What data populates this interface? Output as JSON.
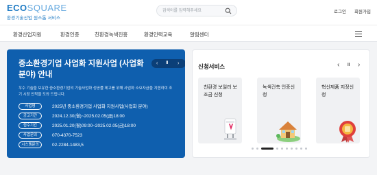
{
  "header": {
    "logo_main": "ECO",
    "logo_light": "SQUARE",
    "logo_sub": "환경기술산업 원스톱 서비스",
    "search_placeholder": "검색어를 입력해주세요",
    "login": "로그인",
    "signup": "회원가입"
  },
  "nav": {
    "items": [
      "환경산업지원",
      "환경인증",
      "친환경녹색진흥",
      "환경인력교육",
      "알림센터"
    ]
  },
  "banner": {
    "title": "중소환경기업 사업화 지원사업 (사업화분야) 안내",
    "description": "우수 기술을 보유한 중소환경기업의 기술사업화 성공률 제고를 위해 사업화 소요자금을 지원하여 조기 시장 안착을 도와 드립니다.",
    "prev": "‹",
    "pause": "II",
    "next": "›",
    "rows": [
      {
        "label": "사업명",
        "value": "2025년 중소환경기업 사업화 지원사업(사업화 분야)"
      },
      {
        "label": "공고기간",
        "value": "2024.12.30(월)~2025.02.05(금)18:00"
      },
      {
        "label": "접수기간",
        "value": "2025.01.20(월)09:00~2025.02.05(금)18:00"
      },
      {
        "label": "사업문의",
        "value": "070-4370-7523"
      },
      {
        "label": "시스템문의",
        "value": "02-2284-1483,5"
      }
    ]
  },
  "services": {
    "title": "신청서비스",
    "prev": "‹",
    "pause": "II",
    "next": "›",
    "cards": [
      {
        "label": "친환경 보일러 보조금 신청"
      },
      {
        "label": "녹색건축 인증신청"
      },
      {
        "label": "혁신제품 지정신청"
      }
    ],
    "pagination": {
      "total": 10,
      "active": 2
    }
  }
}
